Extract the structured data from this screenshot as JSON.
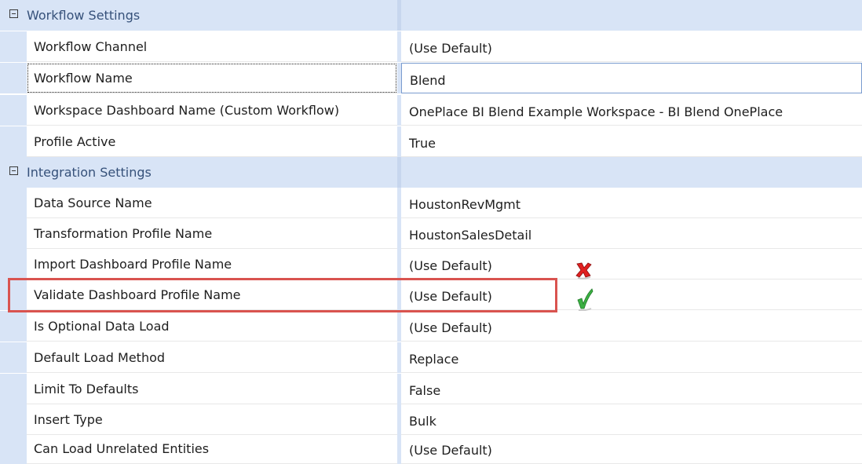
{
  "categories": {
    "workflow": {
      "label": "Workflow Settings"
    },
    "integration": {
      "label": "Integration Settings"
    }
  },
  "rows": [
    {
      "name": "Workflow Channel",
      "value": "(Use Default)"
    },
    {
      "name": "Workflow Name",
      "value": "Blend"
    },
    {
      "name": "Workspace Dashboard Name (Custom Workflow)",
      "value": "OnePlace BI Blend Example Workspace - BI Blend OnePlace"
    },
    {
      "name": "Profile Active",
      "value": "True"
    },
    {
      "name": "Data Source Name",
      "value": "HoustonRevMgmt"
    },
    {
      "name": "Transformation Profile Name",
      "value": "HoustonSalesDetail"
    },
    {
      "name": "Import Dashboard Profile Name",
      "value": "(Use Default)"
    },
    {
      "name": "Validate Dashboard Profile Name",
      "value": "(Use Default)"
    },
    {
      "name": "Is Optional Data Load",
      "value": "(Use Default)"
    },
    {
      "name": "Default Load Method",
      "value": "Replace"
    },
    {
      "name": "Limit To Defaults",
      "value": "False"
    },
    {
      "name": "Insert Type",
      "value": "Bulk"
    },
    {
      "name": "Can Load Unrelated Entities",
      "value": "(Use Default)"
    }
  ],
  "annotations": {
    "highlight_color": "#d9534f",
    "x_color": "#e02020",
    "check_color": "#3cb043",
    "x_icon": "red-x-icon",
    "check_icon": "green-check-icon"
  }
}
